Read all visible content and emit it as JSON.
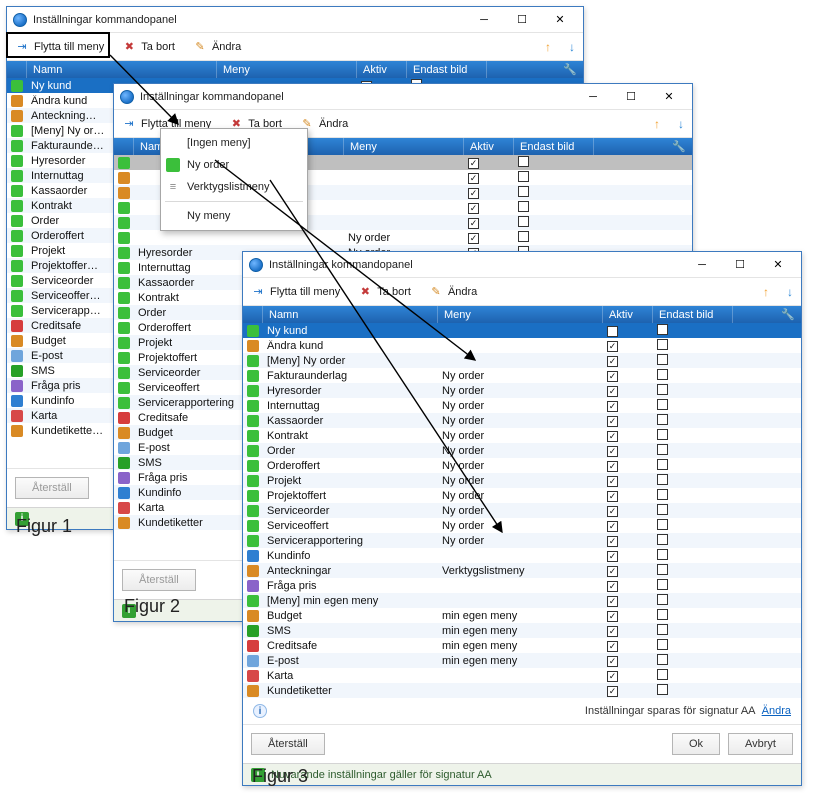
{
  "window_title": "Inställningar kommandopanel",
  "toolbar": {
    "move": "Flytta till meny",
    "remove": "Ta bort",
    "change": "Ändra"
  },
  "columns": {
    "name": "Namn",
    "menu": "Meny",
    "active": "Aktiv",
    "image_only": "Endast bild"
  },
  "captions": {
    "fig1": "Figur 1",
    "fig2": "Figur 2",
    "fig3": "Figur 3"
  },
  "popup": {
    "none": "[Ingen meny]",
    "ny_order": "Ny order",
    "toolmenu": "Verktygslistmeny",
    "new_menu": "Ny meny"
  },
  "footer": {
    "reset": "Återställ",
    "ok": "Ok",
    "cancel": "Avbryt",
    "saved_for": "Inställningar sparas för signatur AA",
    "change_link": "Ändra"
  },
  "status": "Nuvarande inställningar gäller för signatur AA",
  "colors": {
    "green": "#3bbf3b",
    "redstripe": "#d63d3d",
    "blue": "#2f7fd1",
    "smsgreen": "#27a027",
    "orange": "#d98a24",
    "purple": "#8a63c9",
    "pin": "#d74848",
    "envelope": "#6fa5dc",
    "gray": "#9aa0a6"
  },
  "fig1_rows": [
    {
      "icon": "green",
      "name": "Ny kund",
      "sel": true,
      "active": true,
      "img": false
    },
    {
      "icon": "orange",
      "name": "Ändra kund",
      "active": true,
      "img": false
    },
    {
      "icon": "orange",
      "name": "Anteckning…",
      "active": true,
      "img": false
    },
    {
      "icon": "green",
      "name": "[Meny] Ny or…",
      "active": true,
      "img": false
    },
    {
      "icon": "green",
      "name": "Fakturaunde…",
      "active": true,
      "img": false
    },
    {
      "icon": "green",
      "name": "Hyresorder",
      "active": true,
      "img": false
    },
    {
      "icon": "green",
      "name": "Internuttag",
      "active": true,
      "img": false
    },
    {
      "icon": "green",
      "name": "Kassaorder",
      "active": true,
      "img": false
    },
    {
      "icon": "green",
      "name": "Kontrakt",
      "active": true,
      "img": false
    },
    {
      "icon": "green",
      "name": "Order",
      "active": true,
      "img": false
    },
    {
      "icon": "green",
      "name": "Orderoffert",
      "active": true,
      "img": false
    },
    {
      "icon": "green",
      "name": "Projekt",
      "active": true,
      "img": false
    },
    {
      "icon": "green",
      "name": "Projektoffer…",
      "active": true,
      "img": false
    },
    {
      "icon": "green",
      "name": "Serviceorder",
      "active": true,
      "img": false
    },
    {
      "icon": "green",
      "name": "Serviceoffer…",
      "active": true,
      "img": false
    },
    {
      "icon": "green",
      "name": "Servicerapp…",
      "active": true,
      "img": false
    },
    {
      "icon": "redstripe",
      "name": "Creditsafe",
      "active": true,
      "img": false
    },
    {
      "icon": "orange",
      "name": "Budget",
      "active": true,
      "img": false
    },
    {
      "icon": "envelope",
      "name": "E-post",
      "active": true,
      "img": false
    },
    {
      "icon": "smsgreen",
      "name": "SMS",
      "active": true,
      "img": false
    },
    {
      "icon": "purple",
      "name": "Fråga pris",
      "active": true,
      "img": false
    },
    {
      "icon": "blue",
      "name": "Kundinfo",
      "active": true,
      "img": false
    },
    {
      "icon": "pin",
      "name": "Karta",
      "active": true,
      "img": false
    },
    {
      "icon": "orange",
      "name": "Kundetikette…",
      "active": true,
      "img": false
    }
  ],
  "fig2_rows": [
    {
      "icon": "green",
      "name": "",
      "gray": true,
      "menu": "",
      "active": true,
      "img": false
    },
    {
      "icon": "orange",
      "name": "",
      "menu": "",
      "active": true,
      "img": false
    },
    {
      "icon": "orange",
      "name": "",
      "menu": "",
      "active": true,
      "img": false
    },
    {
      "icon": "green",
      "name": "",
      "menu": "",
      "active": true,
      "img": false
    },
    {
      "icon": "green",
      "name": "",
      "menu": "",
      "active": true,
      "img": false
    },
    {
      "icon": "green",
      "name": "",
      "menu": "Ny order",
      "active": true,
      "img": false
    },
    {
      "icon": "green",
      "name": "Hyresorder",
      "menu": "Ny order",
      "active": true,
      "img": false
    },
    {
      "icon": "green",
      "name": "Internuttag",
      "menu": "Ny order",
      "active": true,
      "img": false
    },
    {
      "icon": "green",
      "name": "Kassaorder",
      "menu": "",
      "active": true,
      "img": false
    },
    {
      "icon": "green",
      "name": "Kontrakt",
      "menu": "",
      "active": true,
      "img": false
    },
    {
      "icon": "green",
      "name": "Order",
      "menu": "",
      "active": true,
      "img": false
    },
    {
      "icon": "green",
      "name": "Orderoffert",
      "menu": "",
      "active": true,
      "img": false
    },
    {
      "icon": "green",
      "name": "Projekt",
      "menu": "",
      "active": true,
      "img": false
    },
    {
      "icon": "green",
      "name": "Projektoffert",
      "menu": "",
      "active": true,
      "img": false
    },
    {
      "icon": "green",
      "name": "Serviceorder",
      "menu": "",
      "active": true,
      "img": false
    },
    {
      "icon": "green",
      "name": "Serviceoffert",
      "menu": "",
      "active": true,
      "img": false
    },
    {
      "icon": "green",
      "name": "Servicerapportering",
      "menu": "",
      "active": true,
      "img": false
    },
    {
      "icon": "redstripe",
      "name": "Creditsafe",
      "menu": "",
      "active": true,
      "img": false
    },
    {
      "icon": "orange",
      "name": "Budget",
      "menu": "",
      "active": true,
      "img": false
    },
    {
      "icon": "envelope",
      "name": "E-post",
      "menu": "",
      "active": true,
      "img": false
    },
    {
      "icon": "smsgreen",
      "name": "SMS",
      "menu": "",
      "active": true,
      "img": false
    },
    {
      "icon": "purple",
      "name": "Fråga pris",
      "menu": "",
      "active": true,
      "img": false
    },
    {
      "icon": "blue",
      "name": "Kundinfo",
      "menu": "",
      "active": true,
      "img": false
    },
    {
      "icon": "pin",
      "name": "Karta",
      "menu": "",
      "active": true,
      "img": false
    },
    {
      "icon": "orange",
      "name": "Kundetiketter",
      "menu": "",
      "active": true,
      "img": false
    }
  ],
  "fig3_rows": [
    {
      "icon": "green",
      "name": "Ny kund",
      "menu": "",
      "sel": true,
      "active": true,
      "img": false
    },
    {
      "icon": "orange",
      "name": "Ändra kund",
      "menu": "",
      "active": true,
      "img": false
    },
    {
      "icon": "green",
      "name": "[Meny] Ny order",
      "menu": "",
      "active": true,
      "img": false
    },
    {
      "icon": "green",
      "name": "Fakturaunderlag",
      "menu": "Ny order",
      "active": true,
      "img": false
    },
    {
      "icon": "green",
      "name": "Hyresorder",
      "menu": "Ny order",
      "active": true,
      "img": false
    },
    {
      "icon": "green",
      "name": "Internuttag",
      "menu": "Ny order",
      "active": true,
      "img": false
    },
    {
      "icon": "green",
      "name": "Kassaorder",
      "menu": "Ny order",
      "active": true,
      "img": false
    },
    {
      "icon": "green",
      "name": "Kontrakt",
      "menu": "Ny order",
      "active": true,
      "img": false
    },
    {
      "icon": "green",
      "name": "Order",
      "menu": "Ny order",
      "active": true,
      "img": false
    },
    {
      "icon": "green",
      "name": "Orderoffert",
      "menu": "Ny order",
      "active": true,
      "img": false
    },
    {
      "icon": "green",
      "name": "Projekt",
      "menu": "Ny order",
      "active": true,
      "img": false
    },
    {
      "icon": "green",
      "name": "Projektoffert",
      "menu": "Ny order",
      "active": true,
      "img": false
    },
    {
      "icon": "green",
      "name": "Serviceorder",
      "menu": "Ny order",
      "active": true,
      "img": false
    },
    {
      "icon": "green",
      "name": "Serviceoffert",
      "menu": "Ny order",
      "active": true,
      "img": false
    },
    {
      "icon": "green",
      "name": "Servicerapportering",
      "menu": "Ny order",
      "active": true,
      "img": false
    },
    {
      "icon": "blue",
      "name": "Kundinfo",
      "menu": "",
      "active": true,
      "img": false
    },
    {
      "icon": "orange",
      "name": "Anteckningar",
      "menu": "Verktygslistmeny",
      "active": true,
      "img": false
    },
    {
      "icon": "purple",
      "name": "Fråga pris",
      "menu": "",
      "active": true,
      "img": false
    },
    {
      "icon": "green",
      "name": "[Meny] min egen meny",
      "menu": "",
      "active": true,
      "img": false
    },
    {
      "icon": "orange",
      "name": "Budget",
      "menu": "min egen meny",
      "active": true,
      "img": false
    },
    {
      "icon": "smsgreen",
      "name": "SMS",
      "menu": "min egen meny",
      "active": true,
      "img": false
    },
    {
      "icon": "redstripe",
      "name": "Creditsafe",
      "menu": "min egen meny",
      "active": true,
      "img": false
    },
    {
      "icon": "envelope",
      "name": "E-post",
      "menu": "min egen meny",
      "active": true,
      "img": false
    },
    {
      "icon": "pin",
      "name": "Karta",
      "menu": "",
      "active": true,
      "img": false
    },
    {
      "icon": "orange",
      "name": "Kundetiketter",
      "menu": "",
      "active": true,
      "img": false
    }
  ]
}
